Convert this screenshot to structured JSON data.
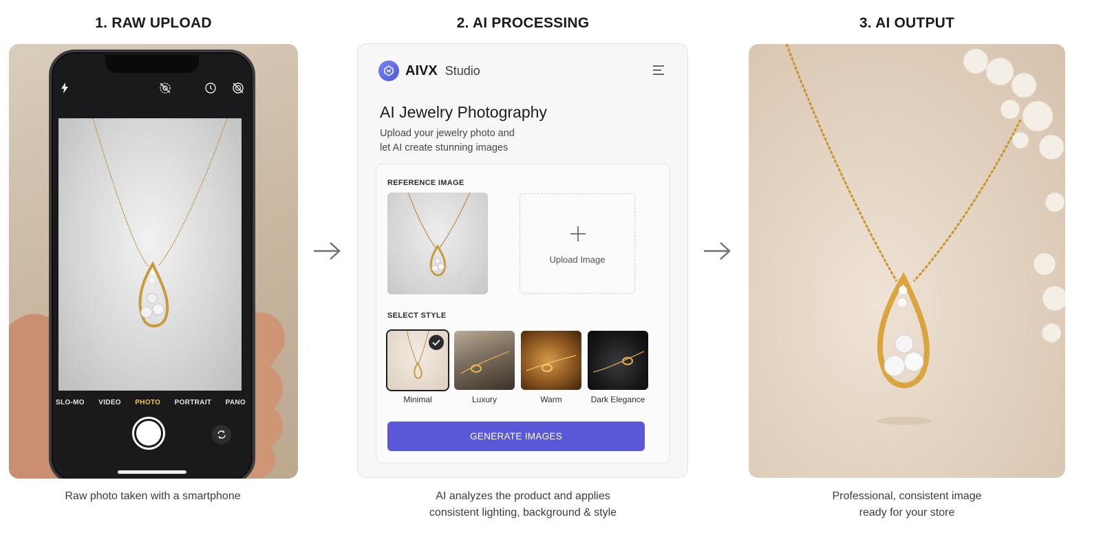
{
  "steps": [
    {
      "title": "1. RAW UPLOAD",
      "caption": [
        "Raw photo taken with a smartphone"
      ]
    },
    {
      "title": "2. AI PROCESSING",
      "caption": [
        "AI analyzes the product and applies",
        "consistent lighting, background & style"
      ]
    },
    {
      "title": "3. AI OUTPUT",
      "caption": [
        "Professional, consistent image",
        "ready for your store"
      ]
    }
  ],
  "camera": {
    "modes": [
      "SLO-MO",
      "VIDEO",
      "PHOTO",
      "PORTRAIT",
      "PANO"
    ],
    "active_mode": "PHOTO",
    "top_icons": [
      "flash-icon",
      "live-photo-icon",
      "timer-icon",
      "filter-icon"
    ]
  },
  "app": {
    "brand_name": "AIVX",
    "brand_sub": "Studio",
    "title": "AI Jewelry Photography",
    "subtitle": [
      "Upload your jewelry photo and",
      "let AI create stunning images"
    ],
    "reference_label": "REFERENCE IMAGE",
    "upload_label": "Upload Image",
    "style_label": "SELECT STYLE",
    "styles": [
      {
        "label": "Minimal",
        "selected": true
      },
      {
        "label": "Luxury",
        "selected": false
      },
      {
        "label": "Warm",
        "selected": false
      },
      {
        "label": "Dark Elegance",
        "selected": false
      }
    ],
    "generate_label": "GENERATE IMAGES",
    "accent_color": "#5a58d6"
  }
}
